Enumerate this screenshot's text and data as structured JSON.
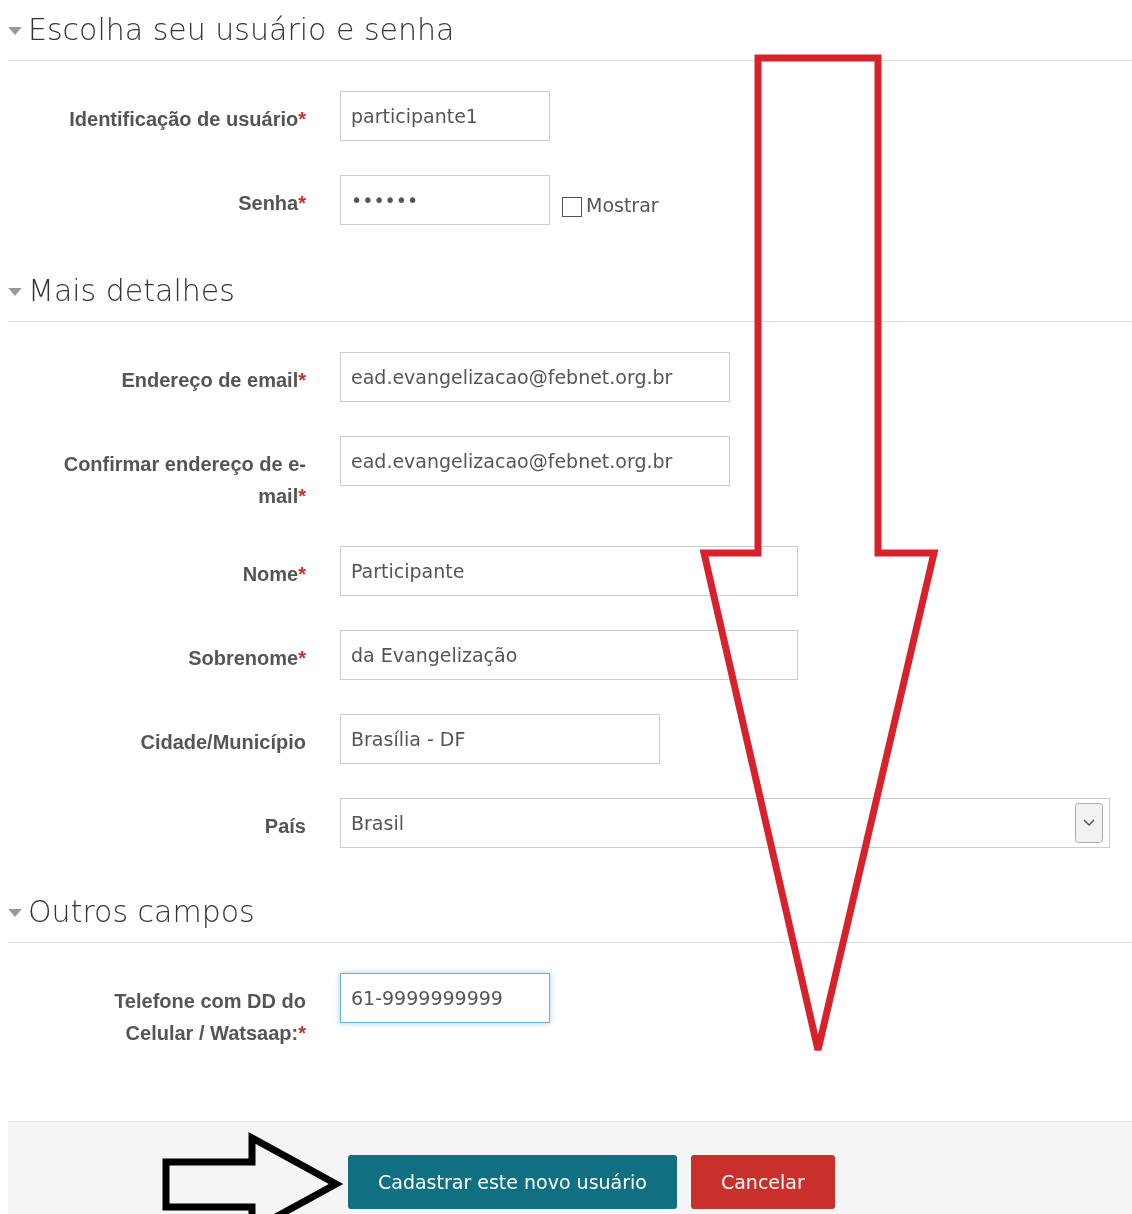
{
  "sections": [
    {
      "title": "Escolha seu usuário e senha",
      "expanded": true,
      "fields": [
        {
          "kind": "text",
          "label": "Identificação de usuário",
          "required_mark": "*",
          "value": "participante1"
        },
        {
          "kind": "password",
          "label": "Senha",
          "required_mark": "*",
          "value": "••••••",
          "show_label": "Mostrar",
          "show_checked": false
        }
      ]
    },
    {
      "title": "Mais detalhes",
      "expanded": true,
      "fields": [
        {
          "kind": "text",
          "label": "Endereço de email",
          "required_mark": "*",
          "value": "ead.evangelizacao@febnet.org.br"
        },
        {
          "kind": "text",
          "label": "Confirmar endereço de e-mail",
          "required_mark": "*",
          "value": "ead.evangelizacao@febnet.org.br"
        },
        {
          "kind": "text",
          "label": "Nome",
          "required_mark": "*",
          "value": "Participante"
        },
        {
          "kind": "text",
          "label": "Sobrenome",
          "required_mark": "*",
          "value": "da Evangelização"
        },
        {
          "kind": "text",
          "label": "Cidade/Município",
          "value": "Brasília - DF"
        },
        {
          "kind": "select",
          "label": "País",
          "value": "Brasil"
        }
      ]
    },
    {
      "title": "Outros campos",
      "expanded": true,
      "fields": [
        {
          "kind": "text",
          "label": "Telefone com DD do Celular / Watsaap:",
          "required_mark": "*",
          "value": "61-9999999999",
          "focused": true
        }
      ]
    }
  ],
  "buttons": [
    {
      "label": "Cadastrar este novo usuário",
      "kind": "primary"
    },
    {
      "label": "Cancelar",
      "kind": "danger"
    }
  ]
}
